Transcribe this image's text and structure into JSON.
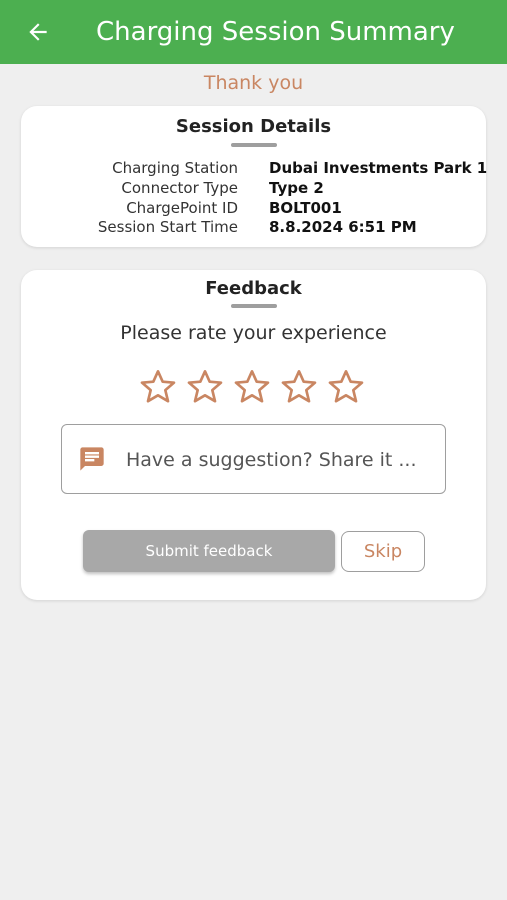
{
  "header": {
    "title": "Charging Session Summary",
    "back_icon": "arrow-left-icon",
    "color": "#4caf50"
  },
  "thank_you": "Thank you",
  "session_details": {
    "title": "Session Details",
    "rows": [
      {
        "label": "Charging Station",
        "value": "Dubai Investments Park 1"
      },
      {
        "label": "Connector Type",
        "value": "Type 2"
      },
      {
        "label": "ChargePoint ID",
        "value": "BOLT001"
      },
      {
        "label": "Session Start Time",
        "value": "8.8.2024 6:51 PM"
      }
    ]
  },
  "feedback": {
    "title": "Feedback",
    "prompt": "Please rate your experience",
    "rating": 0,
    "max_rating": 5,
    "star_icon": "star-outline-icon",
    "suggestion_icon": "chat-icon",
    "suggestion_placeholder": "Have a suggestion? Share it ...",
    "suggestion_value": "",
    "submit_label": "Submit feedback",
    "skip_label": "Skip"
  },
  "colors": {
    "accent": "#c98662",
    "disabled_button": "#a8a8a8",
    "background": "#efefef"
  }
}
